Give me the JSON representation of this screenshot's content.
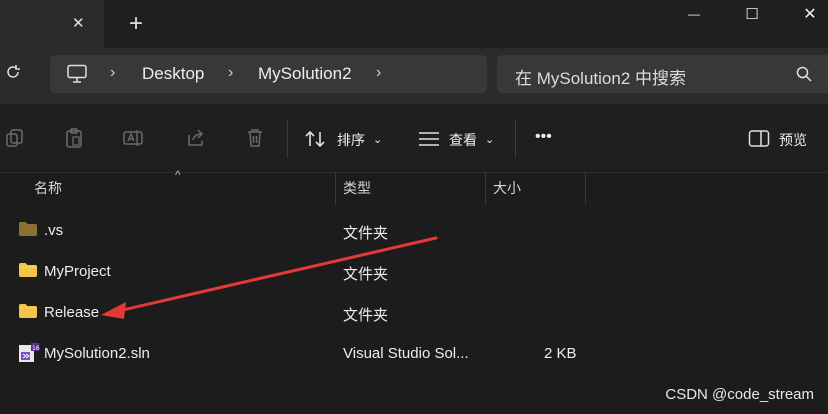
{
  "window": {
    "new_tab": "+",
    "close_tab": "✕",
    "minimize": "—",
    "maximize": "☐",
    "close": "✕"
  },
  "breadcrumb": {
    "items": [
      "Desktop",
      "MySolution2"
    ]
  },
  "search": {
    "placeholder": "在 MySolution2 中搜索"
  },
  "toolbar": {
    "sort_label": "排序",
    "view_label": "查看",
    "more_label": "•••",
    "preview_label": "预览"
  },
  "columns": {
    "name": "名称",
    "type": "类型",
    "size": "大小"
  },
  "files": [
    {
      "name": ".vs",
      "type": "文件夹",
      "size": "",
      "icon": "folder-dark-icon"
    },
    {
      "name": "MyProject",
      "type": "文件夹",
      "size": "",
      "icon": "folder-icon"
    },
    {
      "name": "Release",
      "type": "文件夹",
      "size": "",
      "icon": "folder-icon"
    },
    {
      "name": "MySolution2.sln",
      "type": "Visual Studio Sol...",
      "size": "2 KB",
      "icon": "visual-studio-solution-icon"
    }
  ],
  "watermark": "CSDN @code_stream",
  "colors": {
    "background": "#1c1c1c",
    "address_bar": "#383838",
    "folder": "#f3c546",
    "annotation_arrow": "#e53935"
  }
}
